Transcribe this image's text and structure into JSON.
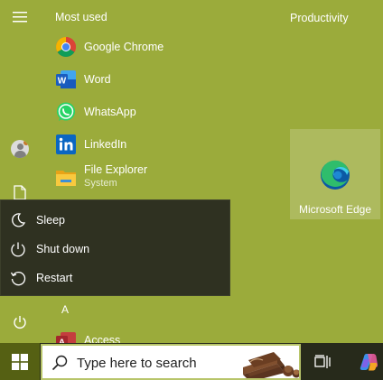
{
  "start_menu": {
    "most_used_title": "Most used",
    "apps": [
      {
        "name": "Google Chrome",
        "icon": "chrome-icon"
      },
      {
        "name": "Word",
        "icon": "word-icon"
      },
      {
        "name": "WhatsApp",
        "icon": "whatsapp-icon"
      },
      {
        "name": "LinkedIn",
        "icon": "linkedin-icon"
      },
      {
        "name": "File Explorer",
        "sub": "System",
        "icon": "file-explorer-icon"
      }
    ],
    "letter_group": "A",
    "letter_apps": [
      {
        "name": "Access",
        "icon": "access-icon"
      }
    ]
  },
  "tiles": {
    "group_title": "Productivity",
    "items": [
      {
        "label": "Microsoft Edge",
        "icon": "edge-icon"
      }
    ]
  },
  "power_menu": {
    "items": [
      {
        "label": "Sleep",
        "icon": "moon-icon"
      },
      {
        "label": "Shut down",
        "icon": "power-icon"
      },
      {
        "label": "Restart",
        "icon": "restart-icon"
      }
    ]
  },
  "taskbar": {
    "search_placeholder": "Type here to search"
  },
  "colors": {
    "desktop_background": "#9bab3b",
    "power_menu_background": "#2f3121",
    "taskbar_background": "#272a1b"
  }
}
